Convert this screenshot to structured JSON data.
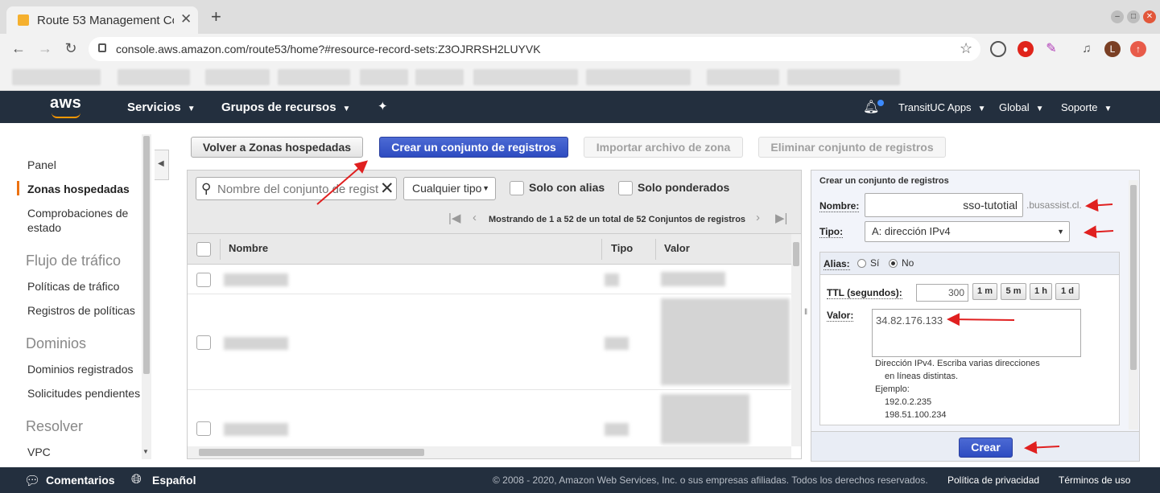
{
  "browser": {
    "tab_title": "Route 53 Management Co",
    "url": "console.aws.amazon.com/route53/home?#resource-record-sets:Z3OJRRSH2LUYVK",
    "profile_initial": "L"
  },
  "aws_nav": {
    "logo": "aws",
    "services": "Servicios",
    "resource_groups": "Grupos de recursos",
    "account": "TransitUC Apps",
    "region": "Global",
    "support": "Soporte"
  },
  "sidebar": {
    "items": [
      {
        "label": "Panel"
      },
      {
        "label": "Zonas hospedadas"
      },
      {
        "label": "Comprobaciones de estado"
      },
      {
        "label": "Políticas de tráfico"
      },
      {
        "label": "Registros de políticas"
      },
      {
        "label": "Dominios registrados"
      },
      {
        "label": "Solicitudes pendientes"
      },
      {
        "label": "VPC"
      }
    ],
    "sections": [
      "Flujo de tráfico",
      "Dominios",
      "Resolver"
    ]
  },
  "toolbar": {
    "back": "Volver a Zonas hospedadas",
    "create": "Crear un conjunto de registros",
    "import": "Importar archivo de zona",
    "delete": "Eliminar conjunto de registros"
  },
  "list": {
    "search_placeholder": "Nombre del conjunto de registros",
    "type_filter": "Cualquier tipo",
    "only_alias": "Solo con alias",
    "only_weighted": "Solo ponderados",
    "pager": "Mostrando de 1 a 52 de un total de 52 Conjuntos de registros",
    "columns": [
      "Nombre",
      "Tipo",
      "Valor"
    ]
  },
  "create_panel": {
    "title": "Crear un conjunto de registros",
    "name_label": "Nombre:",
    "name_value": "sso-tutotial",
    "domain_suffix": ".busassist.cl.",
    "type_label": "Tipo:",
    "type_value": "A: dirección IPv4",
    "alias_label": "Alias:",
    "alias_yes": "Sí",
    "alias_no": "No",
    "ttl_label": "TTL (segundos):",
    "ttl_value": "300",
    "ttl_presets": [
      "1 m",
      "5 m",
      "1 h",
      "1 d"
    ],
    "value_label": "Valor:",
    "value": "34.82.176.133",
    "help_line1": "Dirección IPv4. Escriba varias direcciones",
    "help_line2": "en líneas distintas.",
    "example_label": "Ejemplo:",
    "example_1": "192.0.2.235",
    "example_2": "198.51.100.234",
    "submit": "Crear"
  },
  "footer": {
    "feedback": "Comentarios",
    "language": "Español",
    "copyright": "© 2008 - 2020, Amazon Web Services, Inc. o sus empresas afiliadas. Todos los derechos reservados.",
    "privacy": "Política de privacidad",
    "terms": "Términos de uso"
  },
  "colors": {
    "aws_dark": "#232f3e",
    "primary_button": "#3552c8",
    "annotation_arrow": "#e02020",
    "active_indicator": "#ec7211"
  }
}
